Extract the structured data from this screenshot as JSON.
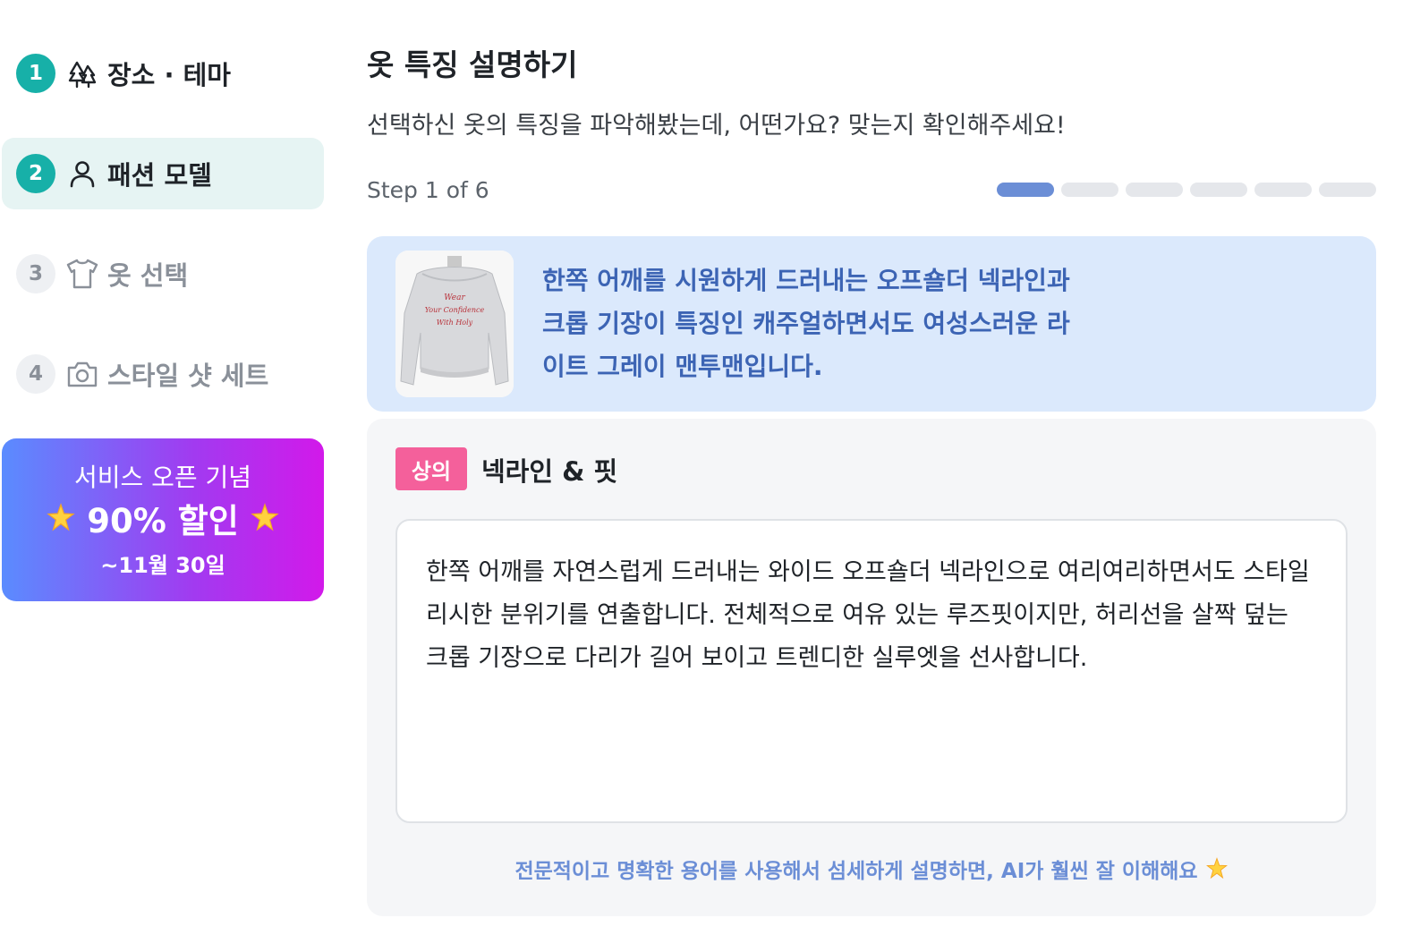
{
  "sidebar": {
    "steps": [
      {
        "number": "1",
        "label": "장소 · 테마",
        "icon": "trees-icon",
        "state": "done"
      },
      {
        "number": "2",
        "label": "패션 모델",
        "icon": "person-icon",
        "state": "active"
      },
      {
        "number": "3",
        "label": "옷 선택",
        "icon": "shirt-icon",
        "state": "todo"
      },
      {
        "number": "4",
        "label": "스타일 샷 세트",
        "icon": "camera-icon",
        "state": "todo"
      }
    ],
    "promo": {
      "line1": "서비스 오픈 기념",
      "line2": "90% 할인",
      "line3": "~11월 30일",
      "icon": "sparkle-icon"
    }
  },
  "main": {
    "title": "옷 특징 설명하기",
    "subtitle": "선택하신 옷의 특징을 파악해봤는데, 어떤가요? 맞는지 확인해주세요!",
    "step_text": "Step 1 of 6",
    "progress": {
      "current": 1,
      "total": 6
    },
    "summary": {
      "text": "한쪽 어깨를 시원하게 드러내는 오프숄더 넥라인과 크롭 기장이 특징인 캐주얼하면서도 여성스러운 라이트 그레이 맨투맨입니다.",
      "image_text": [
        "Wear",
        "Your Confidence",
        "With Holy"
      ]
    },
    "card": {
      "badge": "상의",
      "title": "넥라인 & 핏",
      "description": "한쪽 어깨를 자연스럽게 드러내는 와이드 오프숄더 넥라인으로 여리여리하면서도 스타일리시한 분위기를 연출합니다. 전체적으로 여유 있는 루즈핏이지만, 허리선을 살짝 덮는 크롭 기장으로 다리가 길어 보이고 트렌디한 실루엣을 선사합니다.",
      "hint": "전문적이고 명확한 용어를 사용해서 섬세하게 설명하면, AI가 훨씬 잘 이해해요"
    }
  },
  "colors": {
    "teal": "#17b0a8",
    "active_bg": "#e6f4f3",
    "summary_bg": "#dbe9fc",
    "summary_text": "#3c64b4",
    "badge": "#f4609b",
    "progress_on": "#6b8ed6"
  }
}
